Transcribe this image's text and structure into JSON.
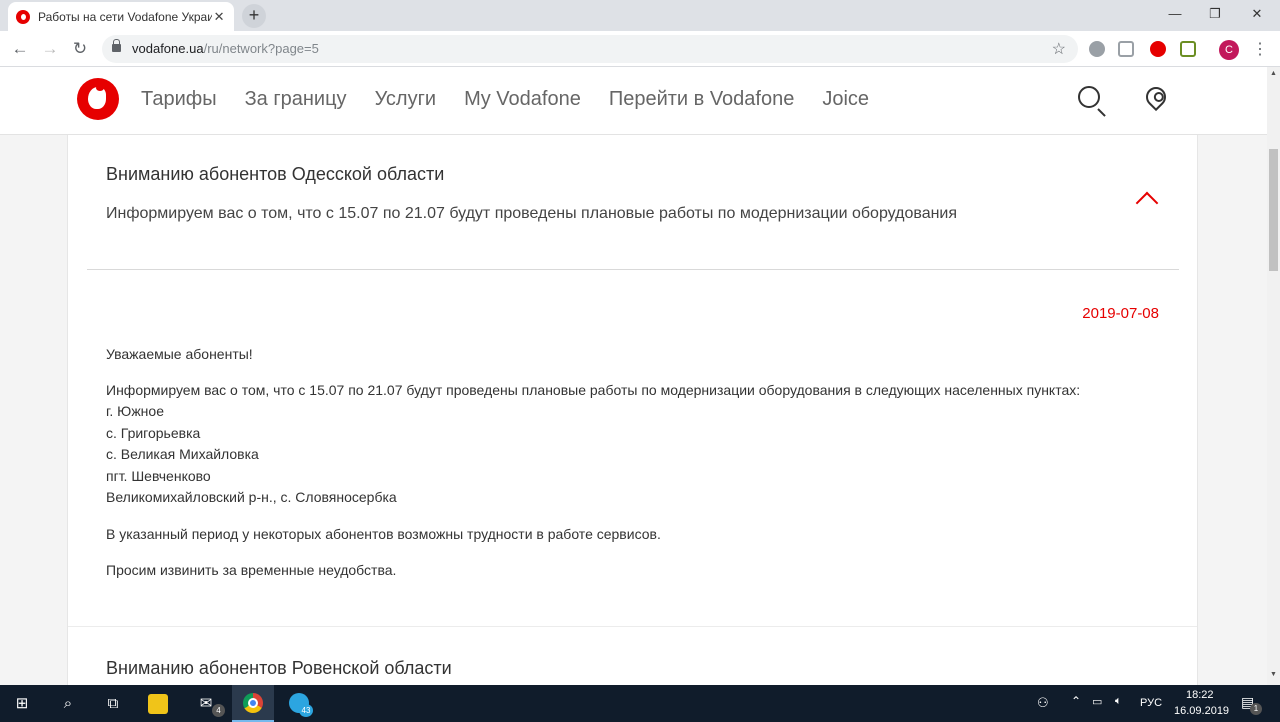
{
  "browser": {
    "tab_title": "Работы на сети Vodafone Украина",
    "tab_close": "✕",
    "new_tab": "+",
    "window_controls": {
      "minimize": "—",
      "restore": "❐",
      "close": "✕"
    },
    "url_host": "vodafone.ua",
    "url_path": "/ru/network?page=5",
    "profile_initial": "С"
  },
  "site": {
    "brand_color": "#e60000",
    "nav": [
      "Тарифы",
      "За границу",
      "Услуги",
      "My Vodafone",
      "Перейти в Vodafone",
      "Joice"
    ]
  },
  "article": {
    "title": "Вниманию абонентов Одесской области",
    "summary": "Информируем вас о том, что с 15.07 по 21.07 будут проведены плановые работы по модернизации оборудования",
    "date": "2019-07-08",
    "greeting": "Уважаемые абоненты!",
    "intro": "Информируем вас о том, что с 15.07 по 21.07 будут проведены плановые работы по модернизации оборудования в следующих населенных пунктах:",
    "places": [
      "г. Южное",
      "с. Григорьевка",
      "с. Великая Михайловка",
      "пгт. Шевченково",
      "Великомихайловский р-н., с. Словяносербка"
    ],
    "note": "В указанный период у некоторых абонентов возможны трудности в работе сервисов.",
    "apology": "Просим извинить за временные неудобства."
  },
  "next_article": {
    "title": "Вниманию абонентов Ровенской области"
  },
  "taskbar": {
    "mail_badge": "4",
    "telegram_badge": "43",
    "language": "РУС",
    "time": "18:22",
    "date": "16.09.2019",
    "notifications": "1"
  }
}
